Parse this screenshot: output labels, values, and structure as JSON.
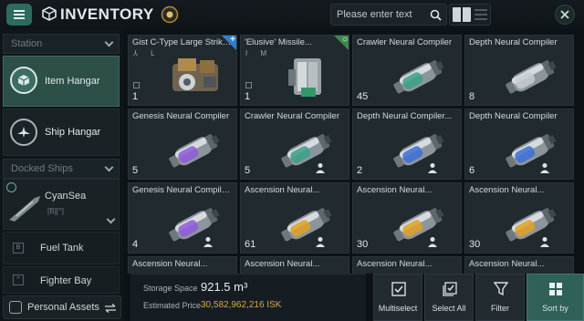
{
  "header": {
    "title": "INVENTORY",
    "search_placeholder": "Please enter text"
  },
  "sidebar": {
    "station_label": "Station",
    "items": [
      {
        "label": "Item Hangar",
        "active": true
      },
      {
        "label": "Ship Hangar",
        "active": false
      }
    ],
    "docked_label": "Docked Ships",
    "ship": {
      "name": "CyanSea",
      "tags": "[B][^]"
    },
    "sub_items": [
      {
        "label": "Fuel Tank",
        "glyph": "B"
      },
      {
        "label": "Fighter Bay",
        "glyph": "^"
      }
    ],
    "assets_label": "Personal Assets"
  },
  "items": [
    {
      "name": "Gist C-Type Large Strike ...",
      "qty": "1",
      "meta": "⅄ L",
      "tag": "+",
      "tag_color": "#2f7fd6",
      "art": "module"
    },
    {
      "name": "'Elusive' Missile...",
      "qty": "1",
      "meta": "I M",
      "tag": "○",
      "tag_color": "#3b8a4f",
      "art": "launcher"
    },
    {
      "name": "Crawler Neural Compiler",
      "qty": "45",
      "accent": "#3aa08a",
      "art": "capsule"
    },
    {
      "name": "Depth Neural Compiler",
      "qty": "8",
      "accent": "#c7cdd2",
      "art": "capsule"
    },
    {
      "name": "Genesis Neural Compiler",
      "qty": "5",
      "accent": "#8f5bdc",
      "art": "capsule"
    },
    {
      "name": "Crawler Neural Compiler",
      "qty": "5",
      "accent": "#3aa08a",
      "art": "capsule",
      "person": true
    },
    {
      "name": "Depth Neural Compiler...",
      "qty": "2",
      "accent": "#3d6fd8",
      "art": "capsule",
      "person": true
    },
    {
      "name": "Depth Neural Compiler",
      "qty": "6",
      "accent": "#3d6fd8",
      "art": "capsule",
      "person": true
    },
    {
      "name": "Genesis Neural Compiler ...",
      "qty": "4",
      "accent": "#8f5bdc",
      "art": "capsule",
      "person": true
    },
    {
      "name": "Ascension Neural...",
      "qty": "61",
      "accent": "#e0a126",
      "art": "capsule",
      "person": true
    },
    {
      "name": "Ascension Neural...",
      "qty": "30",
      "accent": "#e0a126",
      "art": "capsule",
      "person": true
    },
    {
      "name": "Ascension Neural...",
      "qty": "30",
      "accent": "#e0a126",
      "art": "capsule",
      "person": true
    },
    {
      "name": "Ascension Neural...",
      "qty": "",
      "accent": "#e0a126",
      "art": "capsule"
    },
    {
      "name": "Ascension Neural...",
      "qty": "",
      "accent": "#e0a126",
      "art": "capsule"
    },
    {
      "name": "Ascension Neural...",
      "qty": "",
      "accent": "#e0a126",
      "art": "capsule"
    },
    {
      "name": "Ascension Neural...",
      "qty": "",
      "accent": "#e0a126",
      "art": "capsule"
    }
  ],
  "footer": {
    "storage_label": "Storage Space",
    "storage_value": "921.5 m³",
    "price_label": "Estimated Price",
    "price_value": "30,582,962,216 ISK",
    "actions": [
      {
        "label": "Multiselect",
        "icon": "checkbox-icon"
      },
      {
        "label": "Select All",
        "icon": "select-all-icon"
      },
      {
        "label": "Filter",
        "icon": "filter-icon"
      },
      {
        "label": "Sort by",
        "icon": "sort-grid-icon"
      }
    ]
  }
}
